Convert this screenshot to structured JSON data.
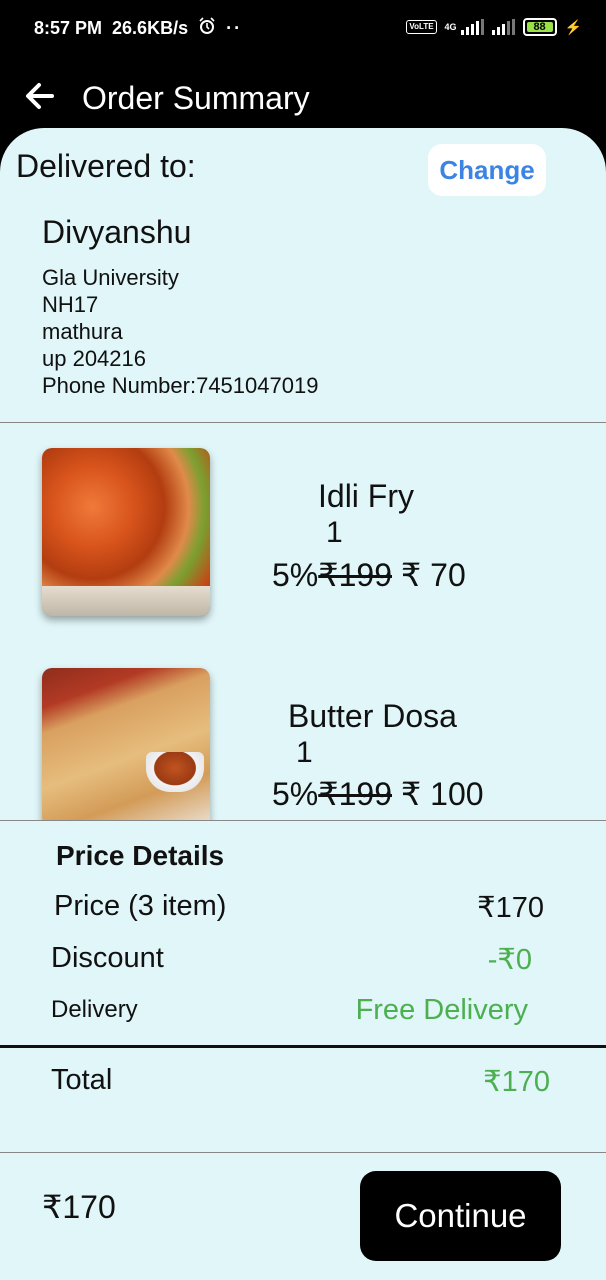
{
  "status_bar": {
    "time": "8:57 PM",
    "speed": "26.6KB/s",
    "dots": "··",
    "network": "4G",
    "volte": "VoLTE",
    "battery": "88",
    "icons": [
      "alarm-icon",
      "volte-icon",
      "signal-icon",
      "battery-icon",
      "charging-icon"
    ]
  },
  "header": {
    "title": "Order Summary",
    "back_icon": "arrow-left-icon"
  },
  "delivery": {
    "label": "Delivered to:",
    "change_label": "Change",
    "name": "Divyanshu",
    "address_lines": [
      "Gla University",
      "NH17",
      "mathura",
      "up 204216",
      "Phone Number:7451047019"
    ]
  },
  "items": [
    {
      "name": "Idli Fry",
      "qty": "1",
      "discount": "5%",
      "original_price": "₹199",
      "price": " ₹ 70"
    },
    {
      "name": "Butter Dosa",
      "qty": "1",
      "discount": "5%",
      "original_price": "₹199",
      "price": " ₹ 100"
    }
  ],
  "price_details": {
    "title": "Price Details",
    "price_label": "Price (3 item)",
    "price_value": "₹170",
    "discount_label": "Discount",
    "discount_value": "-₹0",
    "delivery_label": "Delivery",
    "delivery_value": "Free Delivery",
    "total_label": "Total",
    "total_value": "₹170"
  },
  "footer": {
    "amount": "₹170",
    "continue_label": "Continue"
  },
  "colors": {
    "background": "#e0f6f8",
    "accent_blue": "#3b84e3",
    "green": "#4caf50",
    "dark": "#000000"
  }
}
